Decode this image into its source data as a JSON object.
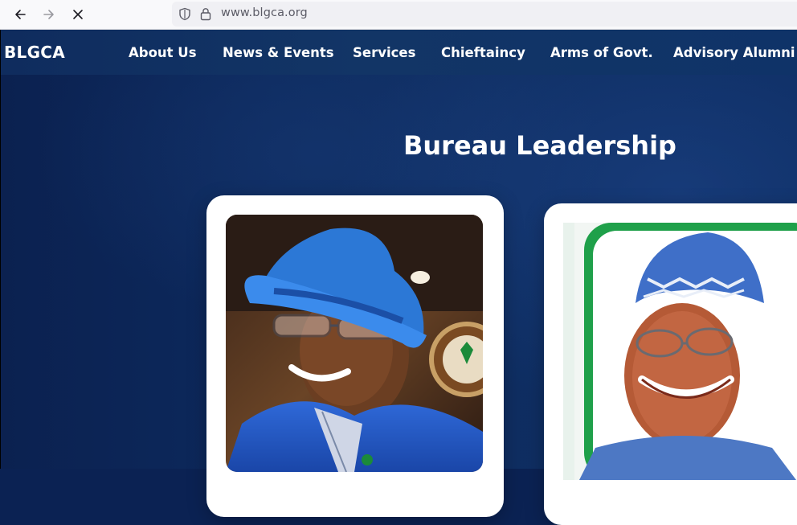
{
  "browser": {
    "url": "www.blgca.org"
  },
  "site": {
    "brand": "BLGCA",
    "menu": [
      {
        "label": "About Us"
      },
      {
        "label": "News & Events"
      },
      {
        "label": "Services"
      },
      {
        "label": "Chieftaincy"
      },
      {
        "label": "Arms of Govt."
      },
      {
        "label": "Advisory Alumni"
      }
    ]
  },
  "main": {
    "section_title": "Bureau Leadership",
    "cards": [
      {
        "photo": "portrait-blue-hat"
      },
      {
        "photo": "portrait-blue-cap"
      }
    ]
  },
  "colors": {
    "nav_background": "#123566",
    "hero_background": "#0d2a5e",
    "card_background": "#ffffff",
    "frame_green": "#1fa04a"
  }
}
